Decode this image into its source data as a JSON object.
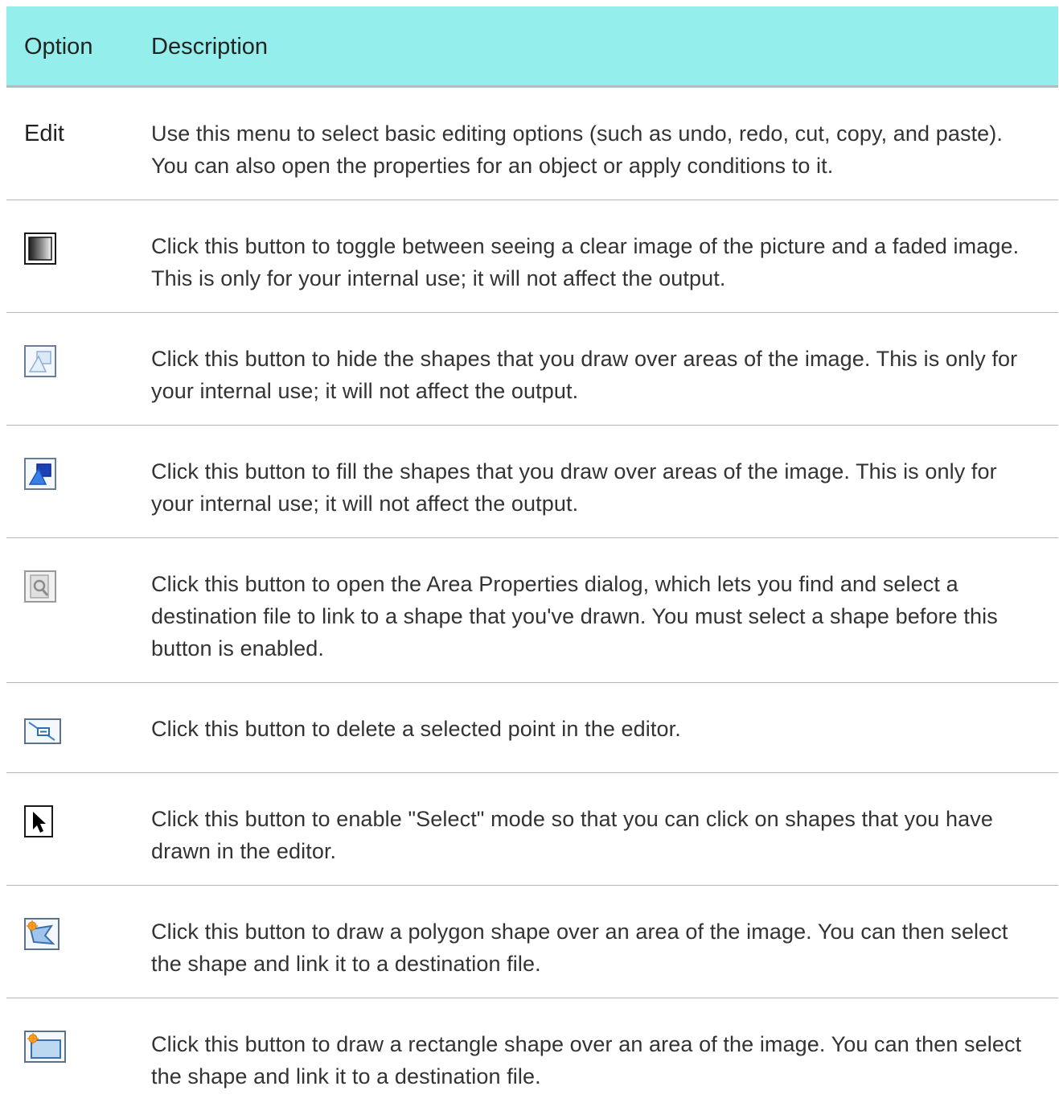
{
  "header": {
    "option_label": "Option",
    "description_label": "Description"
  },
  "rows": [
    {
      "option_text": "Edit",
      "description": "Use this menu to select basic editing options (such as undo, redo, cut, copy, and paste). You can also open the properties for an object or apply conditions to it."
    },
    {
      "option_icon": "toggle-faded-icon",
      "description": "Click this button to toggle between seeing a clear image of the picture and a faded image. This is only for your internal use; it will not affect the output."
    },
    {
      "option_icon": "hide-shapes-icon",
      "description": "Click this button to hide the shapes that you draw over areas of the image. This is only for your internal use; it will not affect the output."
    },
    {
      "option_icon": "fill-shapes-icon",
      "description": "Click this button to fill the shapes that you draw over areas of the image. This is only for your internal use; it will not affect the output."
    },
    {
      "option_icon": "area-properties-icon",
      "description": "Click this button to open the Area Properties dialog, which lets you find and select a destination file to link to a shape that you've drawn. You must select a shape before this button is enabled."
    },
    {
      "option_icon": "delete-point-icon",
      "description": "Click this button to delete a selected point in the editor."
    },
    {
      "option_icon": "select-arrow-icon",
      "description": "Click this button to enable \"Select\" mode so that you can click on shapes that you have drawn in the editor."
    },
    {
      "option_icon": "draw-polygon-icon",
      "description": "Click this button to draw a polygon shape over an area of the image. You can then select the shape and link it to a destination file."
    },
    {
      "option_icon": "draw-rectangle-icon",
      "description": "Click this button to draw a rectangle shape over an area of the image. You can then select the shape and link it to a destination file."
    }
  ],
  "colors": {
    "header_background": "#94efec",
    "row_divider": "#b7b7b7"
  }
}
